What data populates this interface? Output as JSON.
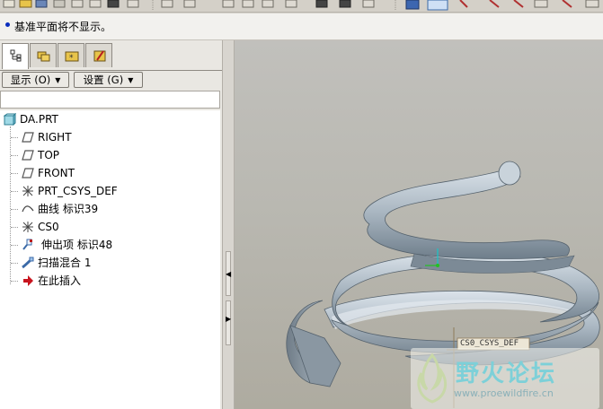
{
  "message": {
    "text": "基准平面将不显示。"
  },
  "model_tree": {
    "show_button": "显示 (O)",
    "settings_button": "设置 (G)",
    "root": "DA.PRT",
    "items": [
      {
        "label": "RIGHT",
        "icon": "datum-plane-icon"
      },
      {
        "label": "TOP",
        "icon": "datum-plane-icon"
      },
      {
        "label": "FRONT",
        "icon": "datum-plane-icon"
      },
      {
        "label": "PRT_CSYS_DEF",
        "icon": "csys-icon"
      },
      {
        "label": "曲线 标识39",
        "icon": "curve-icon"
      },
      {
        "label": "CS0",
        "icon": "csys-icon"
      },
      {
        "label": "伸出项 标识48",
        "icon": "protrusion-icon"
      },
      {
        "label": "扫描混合 1",
        "icon": "swept-blend-icon"
      },
      {
        "label": "在此插入",
        "icon": "insert-here-arrow-icon"
      }
    ]
  },
  "viewport": {
    "csys_label": "CS0_CSYS_DEF",
    "watermark_title": "野火论坛",
    "watermark_url": "www.proewildfire.cn"
  },
  "colors": {
    "message_dot": "#0a2dbd",
    "spring": "#8c9aa6",
    "insert_arrow": "#c8141e"
  }
}
